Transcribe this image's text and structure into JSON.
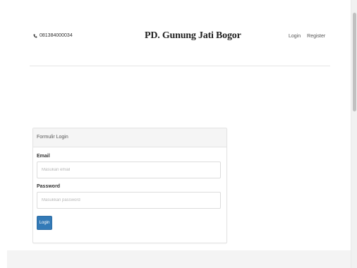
{
  "header": {
    "phone": "081384000034",
    "brand": "PD. Gunung Jati Bogor",
    "nav": {
      "login": "Login",
      "register": "Register"
    }
  },
  "login_panel": {
    "heading": "Formulir Login",
    "email_label": "Email",
    "email_placeholder": "Masukan email",
    "password_label": "Password",
    "password_placeholder": "Masukkan password",
    "submit_label": "Login"
  },
  "colors": {
    "primary_button": "#337ab7",
    "panel_heading_bg": "#f5f5f5"
  },
  "icons": {
    "phone": "phone-icon"
  }
}
